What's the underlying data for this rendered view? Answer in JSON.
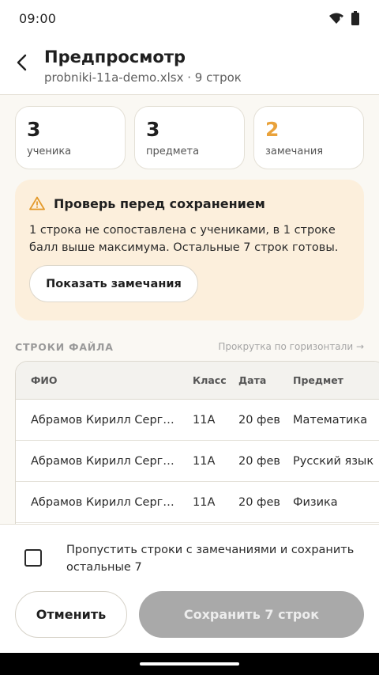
{
  "status_bar": {
    "time": "09:00",
    "icons": [
      "wifi-alert-icon",
      "battery-icon"
    ]
  },
  "header": {
    "title": "Предпросмотр",
    "subtitle": "probniki-11a-demo.xlsx · 9 строк",
    "back_icon": "back-arrow-icon"
  },
  "stats": [
    {
      "value": "3",
      "label": "ученика"
    },
    {
      "value": "3",
      "label": "предмета"
    },
    {
      "value": "2",
      "label": "замечания",
      "accent": "#E9A23B"
    }
  ],
  "warning": {
    "icon": "warning-triangle-icon",
    "title": "Проверь перед сохранением",
    "text": "1 строка не сопоставлена с учениками, в 1 строке балл выше максимума. Остальные 7 строк готовы.",
    "button_label": "Показать замечания"
  },
  "file_rows": {
    "section_title": "СТРОКИ ФАЙЛА",
    "scroll_hint": "Прокрутка по горизонтали →",
    "columns": [
      "ФИО",
      "Класс",
      "Дата",
      "Предмет"
    ],
    "rows": [
      [
        "Абрамов Кирилл Серг…",
        "11А",
        "20 фев",
        "Математика"
      ],
      [
        "Абрамов Кирилл Серг…",
        "11А",
        "20 фев",
        "Русский язык"
      ],
      [
        "Абрамов Кирилл Серг…",
        "11А",
        "20 фев",
        "Физика"
      ]
    ]
  },
  "bottom": {
    "checkbox_label": "Пропустить строки с замечаниями и сохранить остальные 7",
    "checked": false,
    "cancel_label": "Отменить",
    "save_label": "Сохранить 7 строк"
  },
  "colors": {
    "accent": "#E9A23B",
    "warning_bg": "#FCEFDC",
    "disabled_button": "#A9A9A9",
    "page_bg": "#FAF8F3"
  }
}
